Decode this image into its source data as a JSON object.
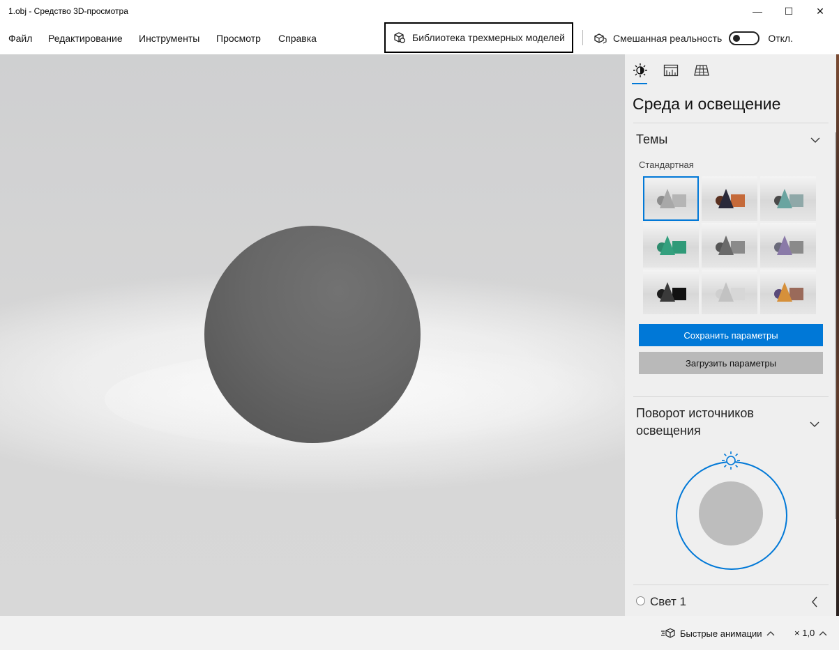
{
  "window": {
    "title": "1.obj - Средство 3D-просмотра",
    "minimize_glyph": "—",
    "maximize_glyph": "☐",
    "close_glyph": "✕"
  },
  "menu": {
    "items": [
      "Файл",
      "Редактирование",
      "Инструменты",
      "Просмотр",
      "Справка"
    ],
    "library_button": "Библиотека трехмерных моделей",
    "mixed_reality_label": "Смешанная реальность",
    "mixed_reality_state": "Откл."
  },
  "panel": {
    "tabs": [
      "environment-lighting-icon",
      "stats-icon",
      "grid-icon"
    ],
    "active_tab": 0,
    "title": "Среда и освещение",
    "themes": {
      "header": "Темы",
      "selected_theme": "Стандартная",
      "thumbnails": [
        {
          "name": "standard",
          "sphere": "#8d8d8d",
          "cone": "#a8a8a8",
          "box": "#b5b5b5"
        },
        {
          "name": "warm-dark",
          "sphere": "#5a3020",
          "cone": "#2a2a3a",
          "box": "#c56a3a"
        },
        {
          "name": "teal-gray",
          "sphere": "#4a4a4a",
          "cone": "#6aa4a0",
          "box": "#8fa8a8"
        },
        {
          "name": "green",
          "sphere": "#2e8c6e",
          "cone": "#34a07e",
          "box": "#2f9a78"
        },
        {
          "name": "dark-gray",
          "sphere": "#555555",
          "cone": "#6a6a6a",
          "box": "#8a8a8a"
        },
        {
          "name": "purple-gray",
          "sphere": "#6a6a7a",
          "cone": "#8a7aa8",
          "box": "#8a8a8a"
        },
        {
          "name": "black",
          "sphere": "#1e1e1e",
          "cone": "#3a3a3a",
          "box": "#111111"
        },
        {
          "name": "light",
          "sphere": "#cfcfcf",
          "cone": "#c2c2c2",
          "box": "#d7d7d7"
        },
        {
          "name": "orange-purple",
          "sphere": "#5a4a7a",
          "cone": "#d6903a",
          "box": "#9a6a5a"
        }
      ],
      "selected_index": 0
    },
    "save_button": "Сохранить параметры",
    "load_button": "Загрузить параметры",
    "rotation_header": "Поворот источников освещения",
    "light1_label": "Свет 1"
  },
  "statusbar": {
    "animations_label": "Быстрые анимации",
    "speed_label": "× 1,0"
  },
  "colors": {
    "accent": "#0078d7",
    "model": "#666666"
  }
}
